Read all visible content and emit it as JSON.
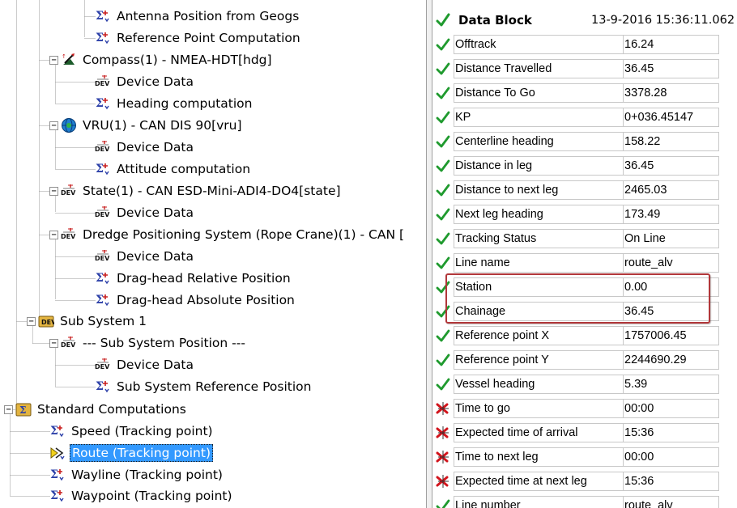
{
  "tree": {
    "items": [
      {
        "label": "Antenna Position from Geogs"
      },
      {
        "label": "Reference Point Computation"
      },
      {
        "label": "Compass(1) - NMEA-HDT[hdg]"
      },
      {
        "label": "Device Data"
      },
      {
        "label": "Heading computation"
      },
      {
        "label": "VRU(1) - CAN DIS 90[vru]"
      },
      {
        "label": "Device Data"
      },
      {
        "label": "Attitude computation"
      },
      {
        "label": "State(1) - CAN ESD-Mini-ADI4-DO4[state]"
      },
      {
        "label": "Device Data"
      },
      {
        "label": "Dredge Positioning System (Rope Crane)(1) - CAN ["
      },
      {
        "label": "Device Data"
      },
      {
        "label": "Drag-head Relative Position"
      },
      {
        "label": "Drag-head Absolute Position"
      },
      {
        "label": "Sub System 1"
      },
      {
        "label": "--- Sub System Position ---"
      },
      {
        "label": "Device Data"
      },
      {
        "label": "Sub System Reference Position"
      },
      {
        "label": "Standard Computations"
      },
      {
        "label": "Speed (Tracking point)"
      },
      {
        "label": "Route (Tracking point)"
      },
      {
        "label": "Wayline (Tracking point)"
      },
      {
        "label": "Waypoint (Tracking point)"
      }
    ]
  },
  "data_block": {
    "title": "Data Block",
    "timestamp": "13-9-2016 15:36:11.062",
    "rows": [
      {
        "name": "Offtrack",
        "value": "16.24",
        "status": "ok"
      },
      {
        "name": "Distance Travelled",
        "value": "36.45",
        "status": "ok"
      },
      {
        "name": "Distance To Go",
        "value": "3378.28",
        "status": "ok"
      },
      {
        "name": "KP",
        "value": "0+036.45147",
        "status": "ok"
      },
      {
        "name": "Centerline heading",
        "value": "158.22",
        "status": "ok"
      },
      {
        "name": "Distance in leg",
        "value": "36.45",
        "status": "ok"
      },
      {
        "name": "Distance to next leg",
        "value": "2465.03",
        "status": "ok"
      },
      {
        "name": "Next leg heading",
        "value": "173.49",
        "status": "ok"
      },
      {
        "name": "Tracking Status",
        "value": "On Line",
        "status": "ok"
      },
      {
        "name": "Line name",
        "value": "route_alv",
        "status": "ok"
      },
      {
        "name": "Station",
        "value": "0.00",
        "status": "ok"
      },
      {
        "name": "Chainage",
        "value": "36.45",
        "status": "ok"
      },
      {
        "name": "Reference point X",
        "value": "1757006.45",
        "status": "ok"
      },
      {
        "name": "Reference point Y",
        "value": "2244690.29",
        "status": "ok"
      },
      {
        "name": "Vessel heading",
        "value": "5.39",
        "status": "ok"
      },
      {
        "name": "Time to go",
        "value": "00:00",
        "status": "error"
      },
      {
        "name": "Expected time of arrival",
        "value": "15:36",
        "status": "error"
      },
      {
        "name": "Time to next leg",
        "value": "00:00",
        "status": "error"
      },
      {
        "name": "Expected time at next leg",
        "value": "15:36",
        "status": "error"
      },
      {
        "name": "Line number",
        "value": "route_alv",
        "status": "ok"
      }
    ]
  },
  "colors": {
    "check_green": "#1f9a2e",
    "error_red": "#d2141c",
    "selection_blue": "#3399ff",
    "highlight_box": "#b1373a"
  },
  "icons": {
    "computation": "sigma-computation-icon",
    "device_data": "device-data-icon",
    "compass": "compass-icon",
    "vru": "vru-globe-icon",
    "subsystem": "subsystem-icon",
    "standard_computations": "standard-computations-icon",
    "selected_computation": "route-arrow-icon",
    "ok": "check-icon",
    "error": "error-x-icon"
  }
}
